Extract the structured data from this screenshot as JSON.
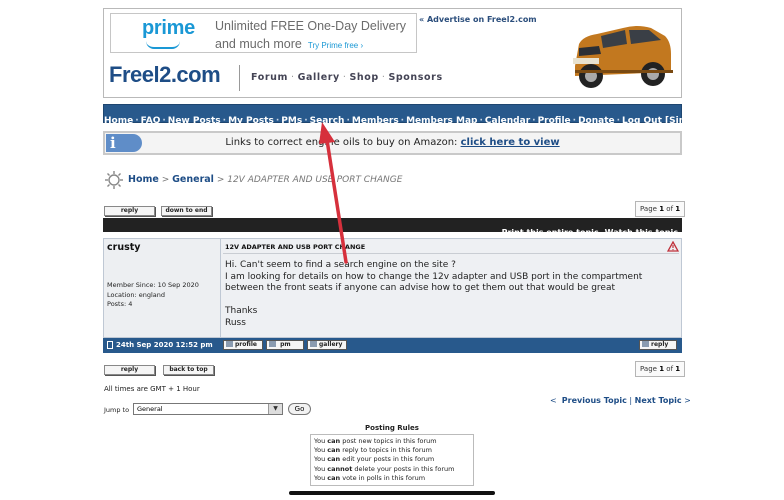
{
  "ad": {
    "prime": "prime",
    "line1": "Unlimited FREE One-Day Delivery",
    "line2": "and much more",
    "trial": "Try Prime free ›",
    "advertise": "« Advertise on Freel2.com"
  },
  "site": {
    "logo": "Freel2.com",
    "nav": [
      "Forum",
      "Gallery",
      "Shop",
      "Sponsors"
    ]
  },
  "navbar": [
    "Home",
    "FAQ",
    "New Posts",
    "My Posts",
    "PMs",
    "Search",
    "Members",
    "Members Map",
    "Calendar",
    "Profile",
    "Donate",
    "Log Out [Simon J]"
  ],
  "info": {
    "text": "Links to correct engine oils to buy on Amazon: ",
    "link": "click here to view"
  },
  "breadcrumb": {
    "home": "Home",
    "sep": ">",
    "forum": "General",
    "topic": "12V ADAPTER AND USB PORT CHANGE"
  },
  "buttons": {
    "reply": "reply",
    "down_to_end": "down to end",
    "back_to_top": "back to top"
  },
  "pagination": {
    "prefix": "Page",
    "current": "1",
    "of": "of",
    "total": "1"
  },
  "topic_actions": [
    "Print this entire topic",
    "Watch this topic"
  ],
  "post": {
    "author": "crusty",
    "member_since": "Member Since: 10 Sep 2020",
    "location": "Location: england",
    "posts": "Posts: 4",
    "subject": "12V ADAPTER AND USB PORT CHANGE",
    "body": "Hi. Can't seem to find a search engine on the site ?\nI am looking for details on how to change the 12v adapter and USB port in the compartment between the front seats if anyone can advise how to get them out that would be great\n\nThanks\nRuss",
    "date": "24th Sep 2020 12:52 pm",
    "actions": [
      "profile",
      "pm",
      "gallery"
    ],
    "reply": "reply"
  },
  "timezone": "All times are GMT + 1 Hour",
  "prev_next": {
    "left": "<",
    "prev": "Previous Topic",
    "sep": "|",
    "next": "Next Topic",
    "right": ">"
  },
  "jump": {
    "label": "Jump to",
    "selected": "General",
    "go": "Go"
  },
  "posting_rules": {
    "title": "Posting Rules",
    "rules": [
      {
        "pre": "You ",
        "b": "can",
        "post": " post new topics in this forum"
      },
      {
        "pre": "You ",
        "b": "can",
        "post": " reply to topics in this forum"
      },
      {
        "pre": "You ",
        "b": "can",
        "post": " edit your posts in this forum"
      },
      {
        "pre": "You ",
        "b": "cannot",
        "post": " delete your posts in this forum"
      },
      {
        "pre": "You ",
        "b": "can",
        "post": " vote in polls in this forum"
      }
    ]
  },
  "colors": {
    "nav": "#28598c",
    "link": "#1e4d86",
    "arrow": "#d6303c",
    "car": "#c2781f"
  }
}
